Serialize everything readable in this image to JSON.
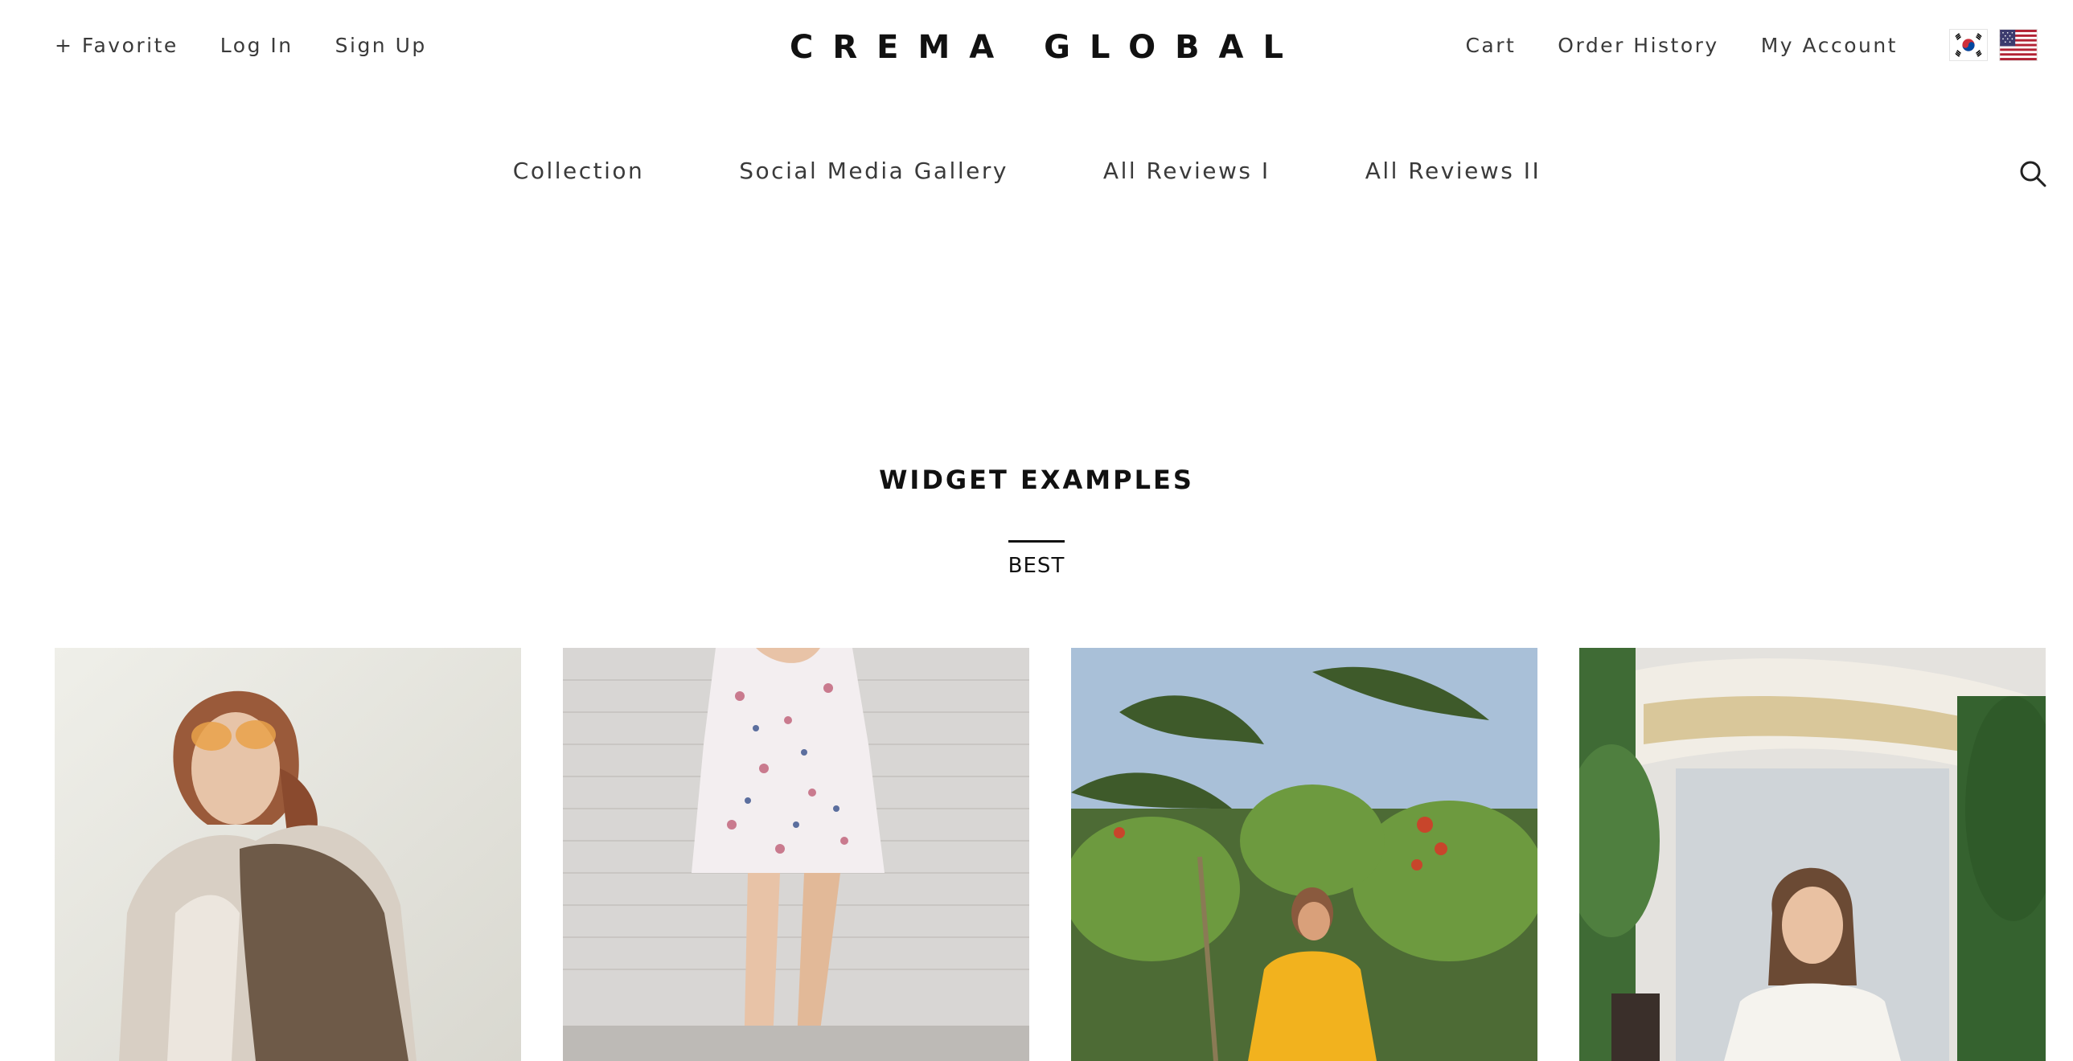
{
  "header": {
    "utility_left": [
      "+ Favorite",
      "Log In",
      "Sign Up"
    ],
    "logo": "CREMA GLOBAL",
    "utility_right": [
      "Cart",
      "Order History",
      "My Account"
    ],
    "flags": [
      "korea-flag-icon",
      "usa-flag-icon"
    ]
  },
  "nav": {
    "items": [
      "Collection",
      "Social Media Gallery",
      "All Reviews I",
      "All Reviews II"
    ],
    "search_icon": "search-icon"
  },
  "section": {
    "title": "WIDGET EXAMPLES",
    "tab": "BEST"
  },
  "gallery": {
    "items": [
      {
        "name": "photo-woman-sunglasses"
      },
      {
        "name": "photo-floral-dress"
      },
      {
        "name": "photo-yellow-dress-palms"
      },
      {
        "name": "photo-woman-street"
      }
    ]
  },
  "colors": {
    "text": "#3a3a3a",
    "heading": "#111111",
    "background": "#ffffff"
  }
}
